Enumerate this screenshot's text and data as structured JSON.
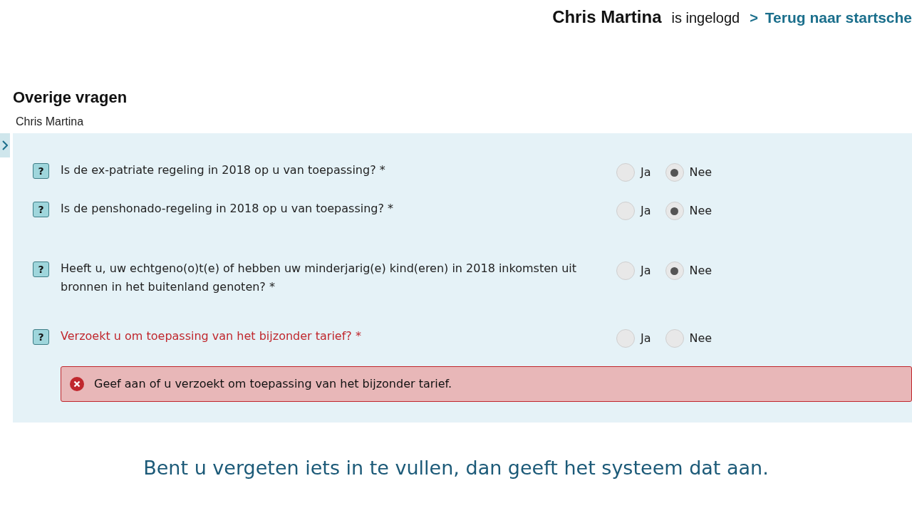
{
  "header": {
    "user": "Chris Martina",
    "status": "is ingelogd",
    "link_prefix": ">",
    "link": "Terug naar startsche"
  },
  "section": {
    "title": "Overige vragen",
    "subtitle": "Chris Martina"
  },
  "questions": [
    {
      "help": "?",
      "text": "Is de ex-patriate regeling in 2018 op u van toepassing? *",
      "error": false,
      "options": [
        {
          "label": "Ja",
          "selected": false
        },
        {
          "label": "Nee",
          "selected": true
        }
      ]
    },
    {
      "help": "?",
      "text": "Is de penshonado-regeling in 2018 op u van toepassing? *",
      "error": false,
      "options": [
        {
          "label": "Ja",
          "selected": false
        },
        {
          "label": "Nee",
          "selected": true
        }
      ]
    },
    {
      "help": "?",
      "text": "Heeft u, uw echtgeno(o)t(e) of hebben uw minderjarig(e) kind(eren) in 2018 inkomsten uit bronnen in het buitenland genoten? *",
      "error": false,
      "options": [
        {
          "label": "Ja",
          "selected": false
        },
        {
          "label": "Nee",
          "selected": true
        }
      ]
    },
    {
      "help": "?",
      "text": "Verzoekt u om toepassing van het bijzonder tarief? *",
      "error": true,
      "error_message": "Geef aan of u verzoekt om toepassing van het bijzonder tarief.",
      "options": [
        {
          "label": "Ja",
          "selected": false
        },
        {
          "label": "Nee",
          "selected": false
        }
      ]
    }
  ],
  "caption": "Bent u vergeten iets in te vullen, dan geeft het systeem dat aan."
}
